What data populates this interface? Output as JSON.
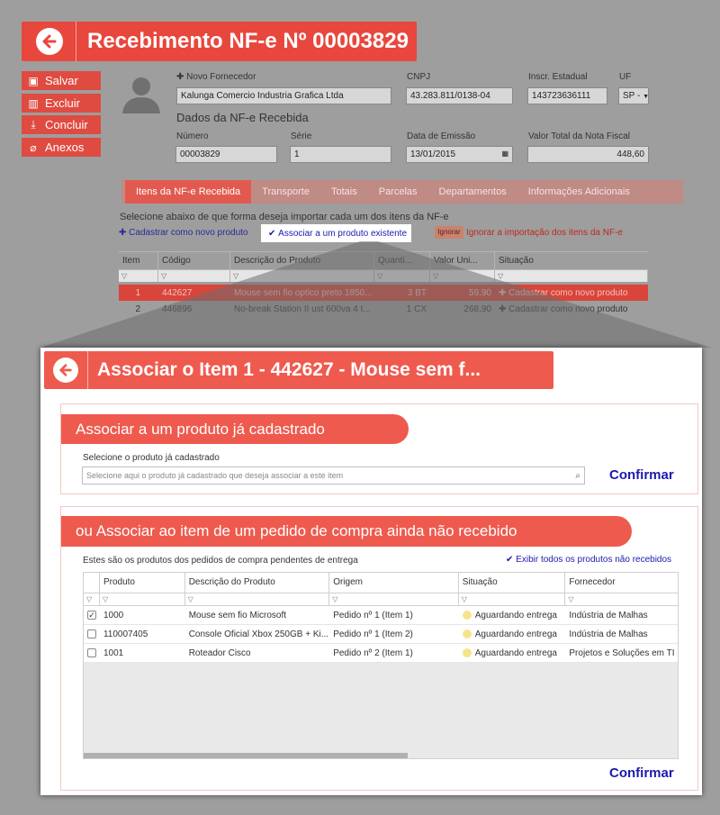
{
  "page": {
    "title": "Recebimento NF-e Nº 00003829",
    "side_buttons": [
      {
        "label": "Salvar",
        "icon": "save-icon"
      },
      {
        "label": "Excluir",
        "icon": "trash-icon"
      },
      {
        "label": "Concluir",
        "icon": "download-icon"
      },
      {
        "label": "Anexos",
        "icon": "paperclip-icon"
      }
    ],
    "supplier": {
      "new_label": "Novo Fornecedor",
      "value": "Kalunga Comercio Industria Grafica Ltda",
      "cnpj_label": "CNPJ",
      "cnpj_value": "43.283.811/0138-04",
      "ie_label": "Inscr. Estadual",
      "ie_value": "143723636111",
      "uf_label": "UF",
      "uf_value": "SP -"
    },
    "nfe": {
      "heading": "Dados da NF-e Recebida",
      "numero_label": "Número",
      "numero_value": "00003829",
      "serie_label": "Série",
      "serie_value": "1",
      "data_label": "Data de Emissão",
      "data_value": "13/01/2015",
      "total_label": "Valor Total da Nota Fiscal",
      "total_value": "448,60"
    },
    "tabs": [
      "Itens da NF-e Recebida",
      "Transporte",
      "Totais",
      "Parcelas",
      "Departamentos",
      "Informações Adicionais"
    ],
    "import_prompt": "Selecione abaixo de que forma deseja importar cada um dos itens da NF-e",
    "option_new": "Cadastrar como novo produto",
    "option_associate": "Associar a um produto existente",
    "ignore_badge": "Ignorar",
    "ignore_text": "Ignorar a importação dos itens da NF-e",
    "items_columns": [
      "Item",
      "Código",
      "Descrição do Produto",
      "Quanti...",
      "Valor Uni...",
      "Situação"
    ],
    "items": [
      {
        "item": "1",
        "codigo": "442627",
        "descricao": "Mouse sem fio optico preto 1850...",
        "qtd": "3 BT",
        "valor": "59,90",
        "situacao": "Cadastrar como novo produto"
      },
      {
        "item": "2",
        "codigo": "446896",
        "descricao": "No-break Station II ust 600va 4 t...",
        "qtd": "1 CX",
        "valor": "268,90",
        "situacao": "Cadastrar como novo produto"
      }
    ]
  },
  "modal": {
    "title": "Associar o Item 1 - 442627 - Mouse sem f...",
    "section1": {
      "heading": "Associar a um produto já cadastrado",
      "field_label": "Selecione o produto já cadastrado",
      "placeholder": "Selecione aqui o produto já cadastrado que deseja associar a este item",
      "confirm": "Confirmar"
    },
    "section2": {
      "heading": "ou Associar ao item de um pedido de compra ainda não recebido",
      "description": "Estes são os produtos dos pedidos de compra pendentes de entrega",
      "show_all": "Exibir todos os produtos não recebidos",
      "columns": [
        "Produto",
        "Descrição do Produto",
        "Origem",
        "Situação",
        "Fornecedor"
      ],
      "rows": [
        {
          "checked": true,
          "produto": "1000",
          "descricao": "Mouse sem fio Microsoft",
          "origem": "Pedido nº 1 (Item 1)",
          "situacao": "Aguardando entrega",
          "fornecedor": "Indústria de Malhas"
        },
        {
          "checked": false,
          "produto": "110007405",
          "descricao": "Console Oficial Xbox 250GB + Ki...",
          "origem": "Pedido nº 1 (Item 2)",
          "situacao": "Aguardando entrega",
          "fornecedor": "Indústria de Malhas"
        },
        {
          "checked": false,
          "produto": "1001",
          "descricao": "Roteador Cisco",
          "origem": "Pedido nº 2 (Item 1)",
          "situacao": "Aguardando entrega",
          "fornecedor": "Projetos e Soluções em TI"
        }
      ],
      "confirm": "Confirmar"
    }
  },
  "colors": {
    "accent": "#ef5a4e",
    "dimmed_bg": "#9e9e9e",
    "link": "#1a1ab0"
  }
}
